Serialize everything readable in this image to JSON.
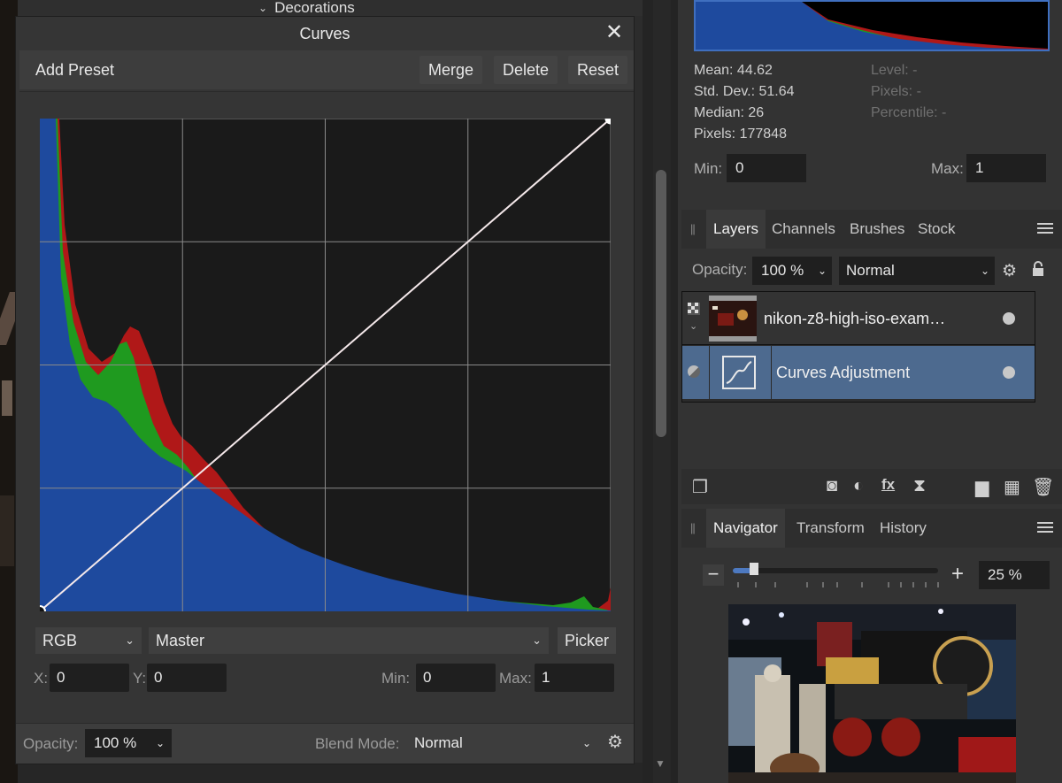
{
  "background": {
    "decorations_label": "Decorations"
  },
  "curves": {
    "title": "Curves",
    "add_preset": "Add Preset",
    "merge": "Merge",
    "delete": "Delete",
    "reset": "Reset",
    "channel": "RGB",
    "mode": "Master",
    "picker": "Picker",
    "x_label": "X:",
    "x_value": "0",
    "y_label": "Y:",
    "y_value": "0",
    "min_label": "Min:",
    "min_value": "0",
    "max_label": "Max:",
    "max_value": "1",
    "opacity_label": "Opacity:",
    "opacity_value": "100 %",
    "blend_label": "Blend Mode:",
    "blend_value": "Normal",
    "colors": {
      "red": "#b01818",
      "green": "#1f9a1f",
      "blue": "#1e4a9e",
      "line": "#ffffff"
    }
  },
  "histogram": {
    "mean": "Mean: 44.62",
    "std_dev": "Std. Dev.: 51.64",
    "median": "Median: 26",
    "pixels": "Pixels: 177848",
    "level": "Level: -",
    "pixels_r": "Pixels: -",
    "percentile": "Percentile: -",
    "min_label": "Min:",
    "min_value": "0",
    "max_label": "Max:",
    "max_value": "1"
  },
  "layers": {
    "tabs": [
      "Layers",
      "Channels",
      "Brushes",
      "Stock"
    ],
    "opacity_label": "Opacity:",
    "opacity_value": "100 %",
    "blend_value": "Normal",
    "items": [
      {
        "name": "nikon-z8-high-iso-exam…"
      },
      {
        "name": "Curves Adjustment"
      }
    ]
  },
  "navigator": {
    "tabs": [
      "Navigator",
      "Transform",
      "History"
    ],
    "zoom_value": "25 %",
    "zoom_fraction": 0.1
  }
}
